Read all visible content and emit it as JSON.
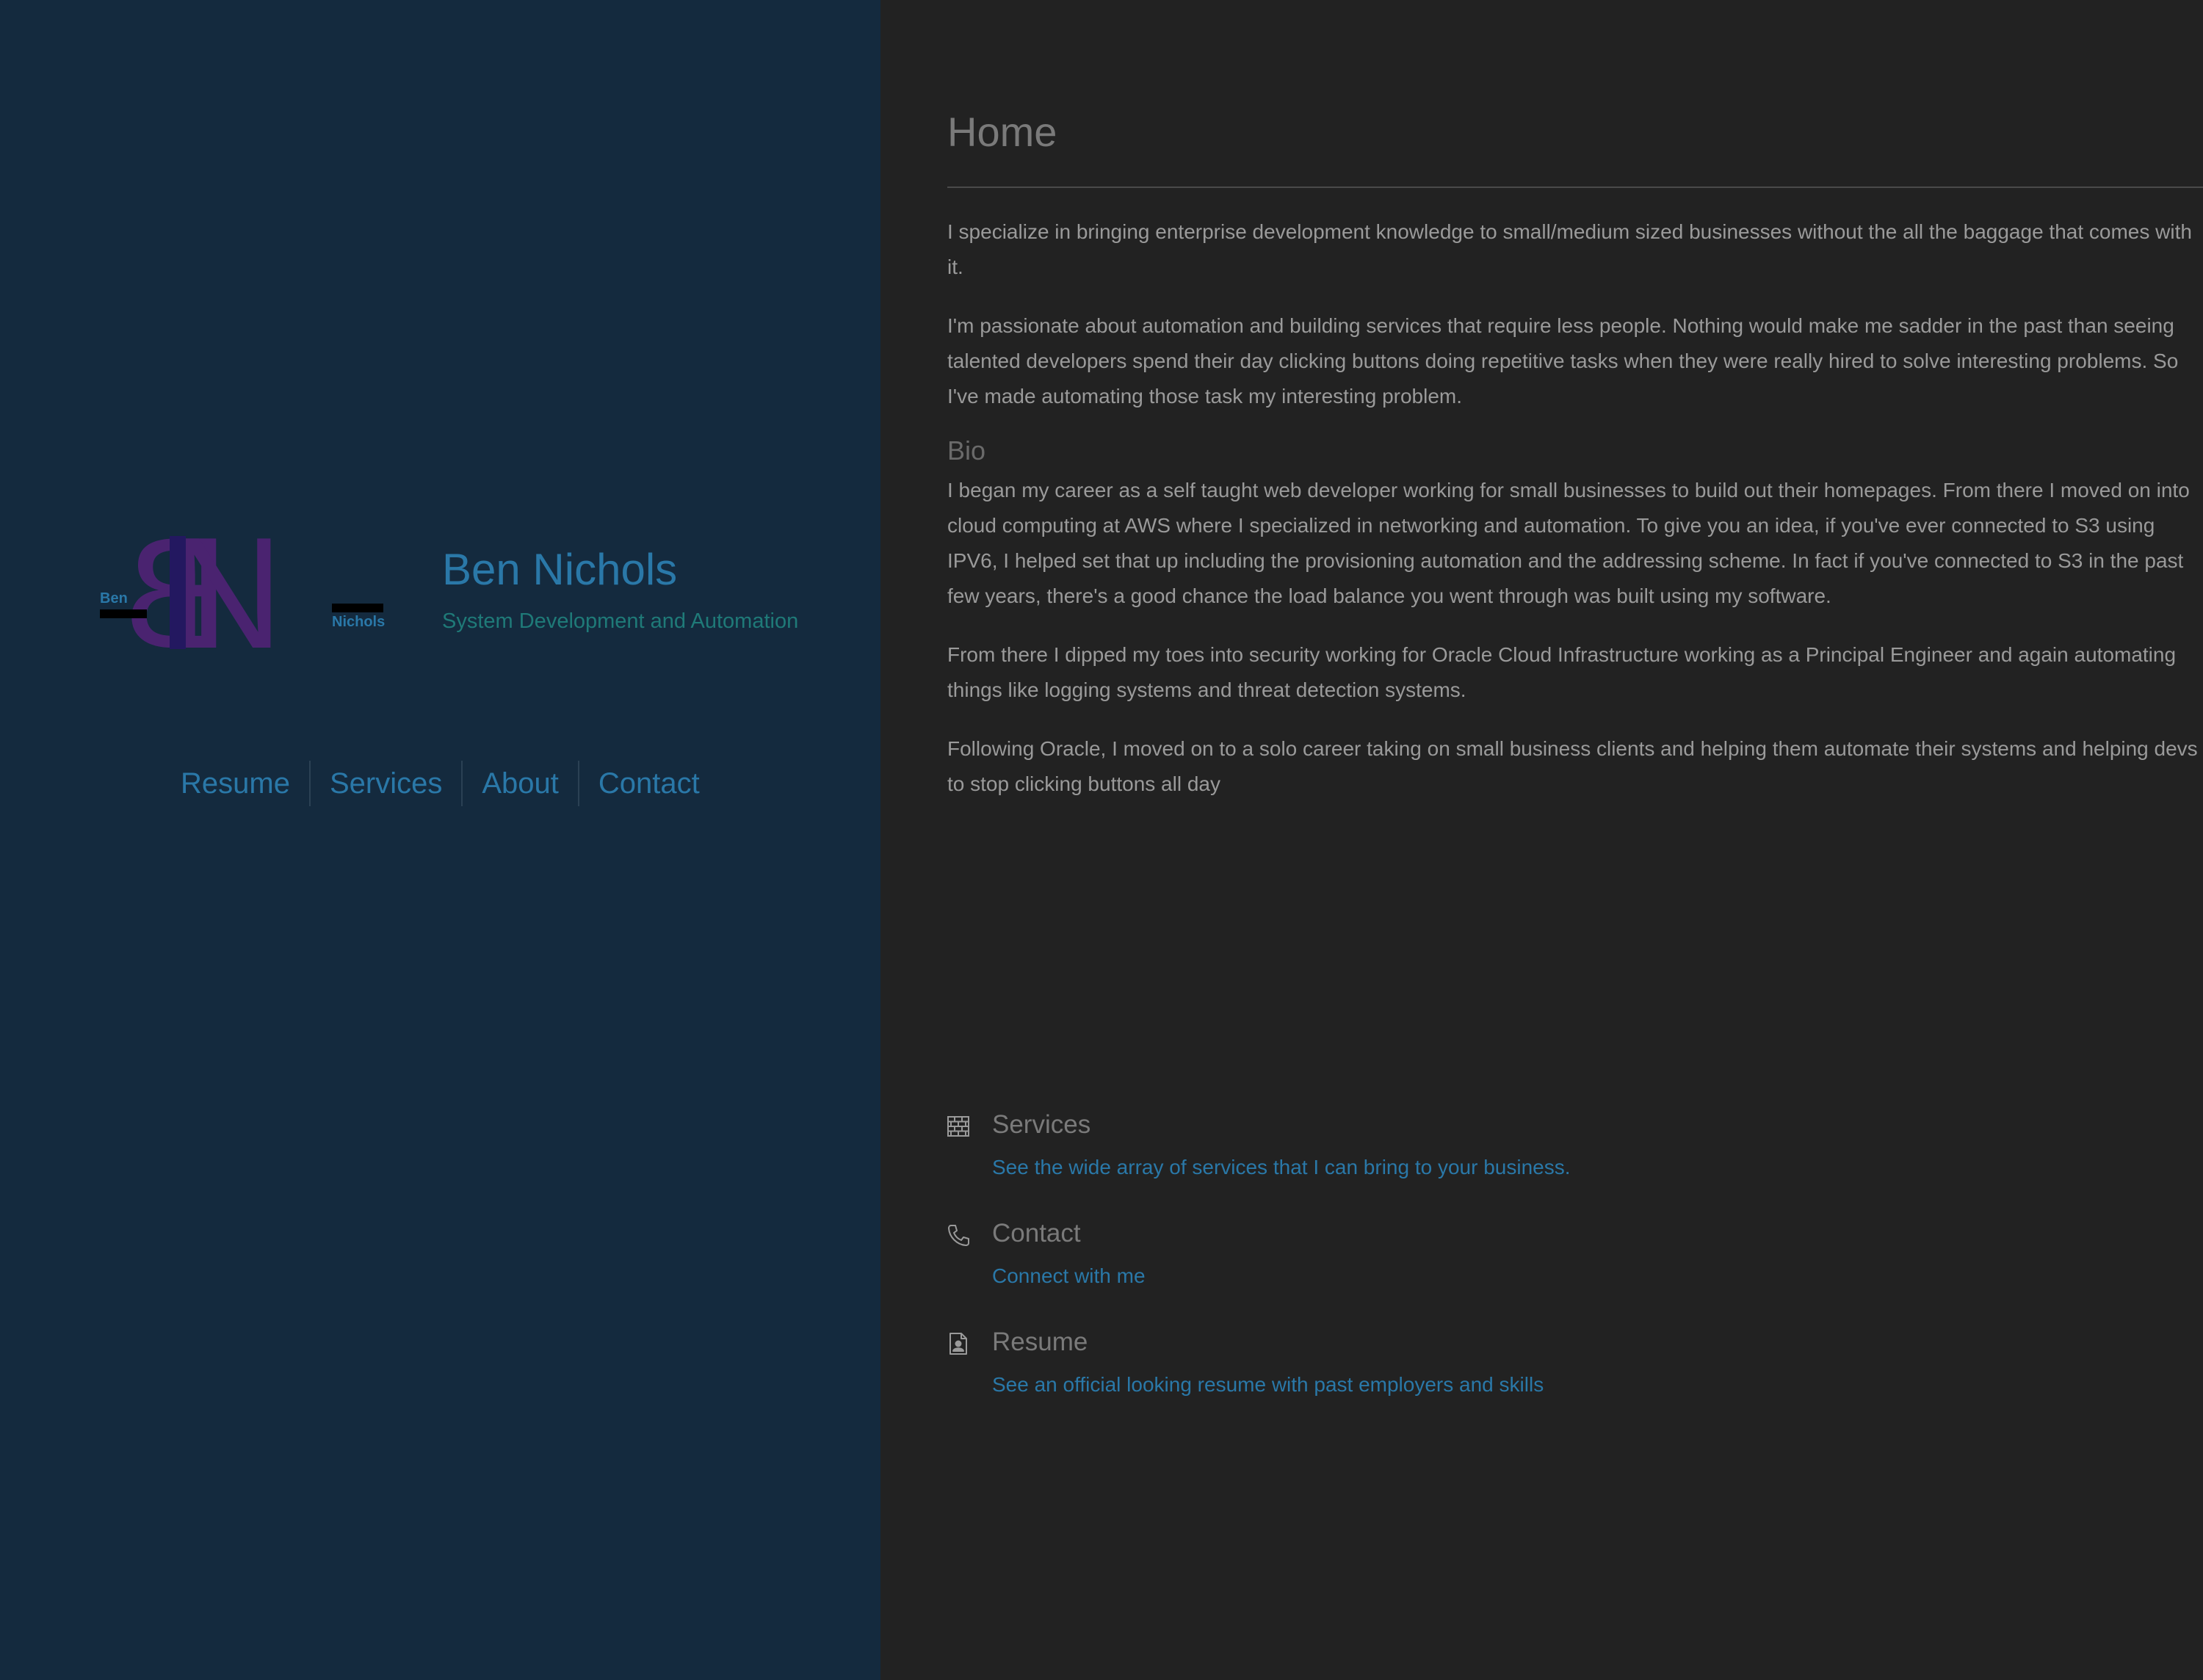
{
  "colors": {
    "sidebar_bg": "#142a3e",
    "main_bg": "#222222",
    "accent": "#2a78a8",
    "tagline": "#1f7a78",
    "body_text": "#9a9a9a",
    "heading_text": "#7a7a7a",
    "logo_purple": "#4a2370",
    "logo_indigo": "#231860"
  },
  "sidebar": {
    "logo": {
      "letters": "BN",
      "small_left": "Ben",
      "small_right": "Nichols"
    },
    "name": "Ben Nichols",
    "tagline": "System Development and Automation",
    "nav": [
      {
        "label": "Resume"
      },
      {
        "label": "Services"
      },
      {
        "label": "About"
      },
      {
        "label": "Contact"
      }
    ]
  },
  "main": {
    "title": "Home",
    "intro": [
      "I specialize in bringing enterprise development knowledge to small/medium sized businesses without the all the baggage that comes with it.",
      "I'm passionate about automation and building services that require less people. Nothing would make me sadder in the past than seeing talented developers spend their day clicking buttons doing repetitive tasks when they were really hired to solve interesting problems. So I've made automating those task my interesting problem."
    ],
    "bio_heading": "Bio",
    "bio": [
      "I began my career as a self taught web developer working for small businesses to build out their homepages. From there I moved on into cloud computing at AWS where I specialized in networking and automation. To give you an idea, if you've ever connected to S3 using IPV6, I helped set that up including the provisioning automation and the addressing scheme. In fact if you've connected to S3 in the past few years, there's a good chance the load balance you went through was built using my software.",
      "From there I dipped my toes into security working for Oracle Cloud Infrastructure working as a Principal Engineer and again automating things like logging systems and threat detection systems.",
      "Following Oracle, I moved on to a solo career taking on small business clients and helping them automate their systems and helping devs to stop clicking buttons all day"
    ],
    "links": [
      {
        "icon": "brick-wall-icon",
        "title": "Services",
        "description": "See the wide array of services that I can bring to your business."
      },
      {
        "icon": "phone-icon",
        "title": "Contact",
        "description": "Connect with me"
      },
      {
        "icon": "resume-file-icon",
        "title": "Resume",
        "description": "See an official looking resume with past employers and skills"
      }
    ]
  }
}
